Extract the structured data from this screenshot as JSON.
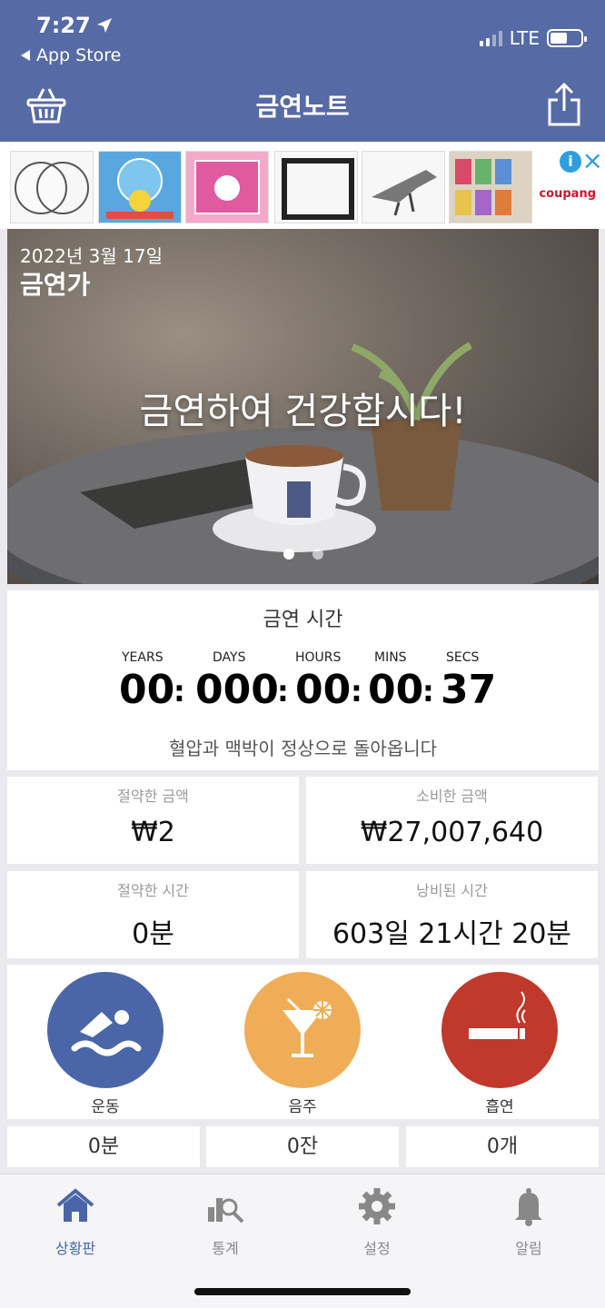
{
  "status_bar": {
    "time": "7:27",
    "back_label": "App Store",
    "network": "LTE",
    "battery_level": 0.55
  },
  "nav": {
    "title": "금연노트"
  },
  "ad": {
    "brand": "coupang"
  },
  "hero": {
    "date": "2022년 3월 17일",
    "subtitle": "금연가",
    "message": "금연하여 건강합시다!",
    "page_count": 2,
    "active_page": 0
  },
  "timer": {
    "title": "금연 시간",
    "labels": {
      "years": "YEARS",
      "days": "DAYS",
      "hours": "HOURS",
      "mins": "MINS",
      "secs": "SECS"
    },
    "values": {
      "years": "00",
      "days": "000",
      "hours": "00",
      "mins": "00",
      "secs": "37"
    },
    "separator": ":",
    "message": "혈압과 맥박이 정상으로 돌아옵니다"
  },
  "stats": [
    {
      "label": "절약한 금액",
      "value": "₩2"
    },
    {
      "label": "소비한 금액",
      "value": "₩27,007,640"
    },
    {
      "label": "절약한 시간",
      "value": "0분"
    },
    {
      "label": "낭비된 시간",
      "value": "603일 21시간 20분"
    }
  ],
  "activities": [
    {
      "label": "운동",
      "count": "0분",
      "color": "#4a66a8",
      "icon": "swimmer-icon"
    },
    {
      "label": "음주",
      "count": "0잔",
      "color": "#f0ad57",
      "icon": "cocktail-icon"
    },
    {
      "label": "흡연",
      "count": "0개",
      "color": "#c0392b",
      "icon": "cigarette-icon"
    }
  ],
  "tabs": [
    {
      "label": "상황판",
      "icon": "home-icon",
      "active": true
    },
    {
      "label": "통계",
      "icon": "stats-icon",
      "active": false
    },
    {
      "label": "설정",
      "icon": "gear-icon",
      "active": false
    },
    {
      "label": "알림",
      "icon": "bell-icon",
      "active": false
    }
  ],
  "colors": {
    "primary": "#566aa6",
    "active_tab": "#4a66a8",
    "inactive_tab": "#888888"
  }
}
